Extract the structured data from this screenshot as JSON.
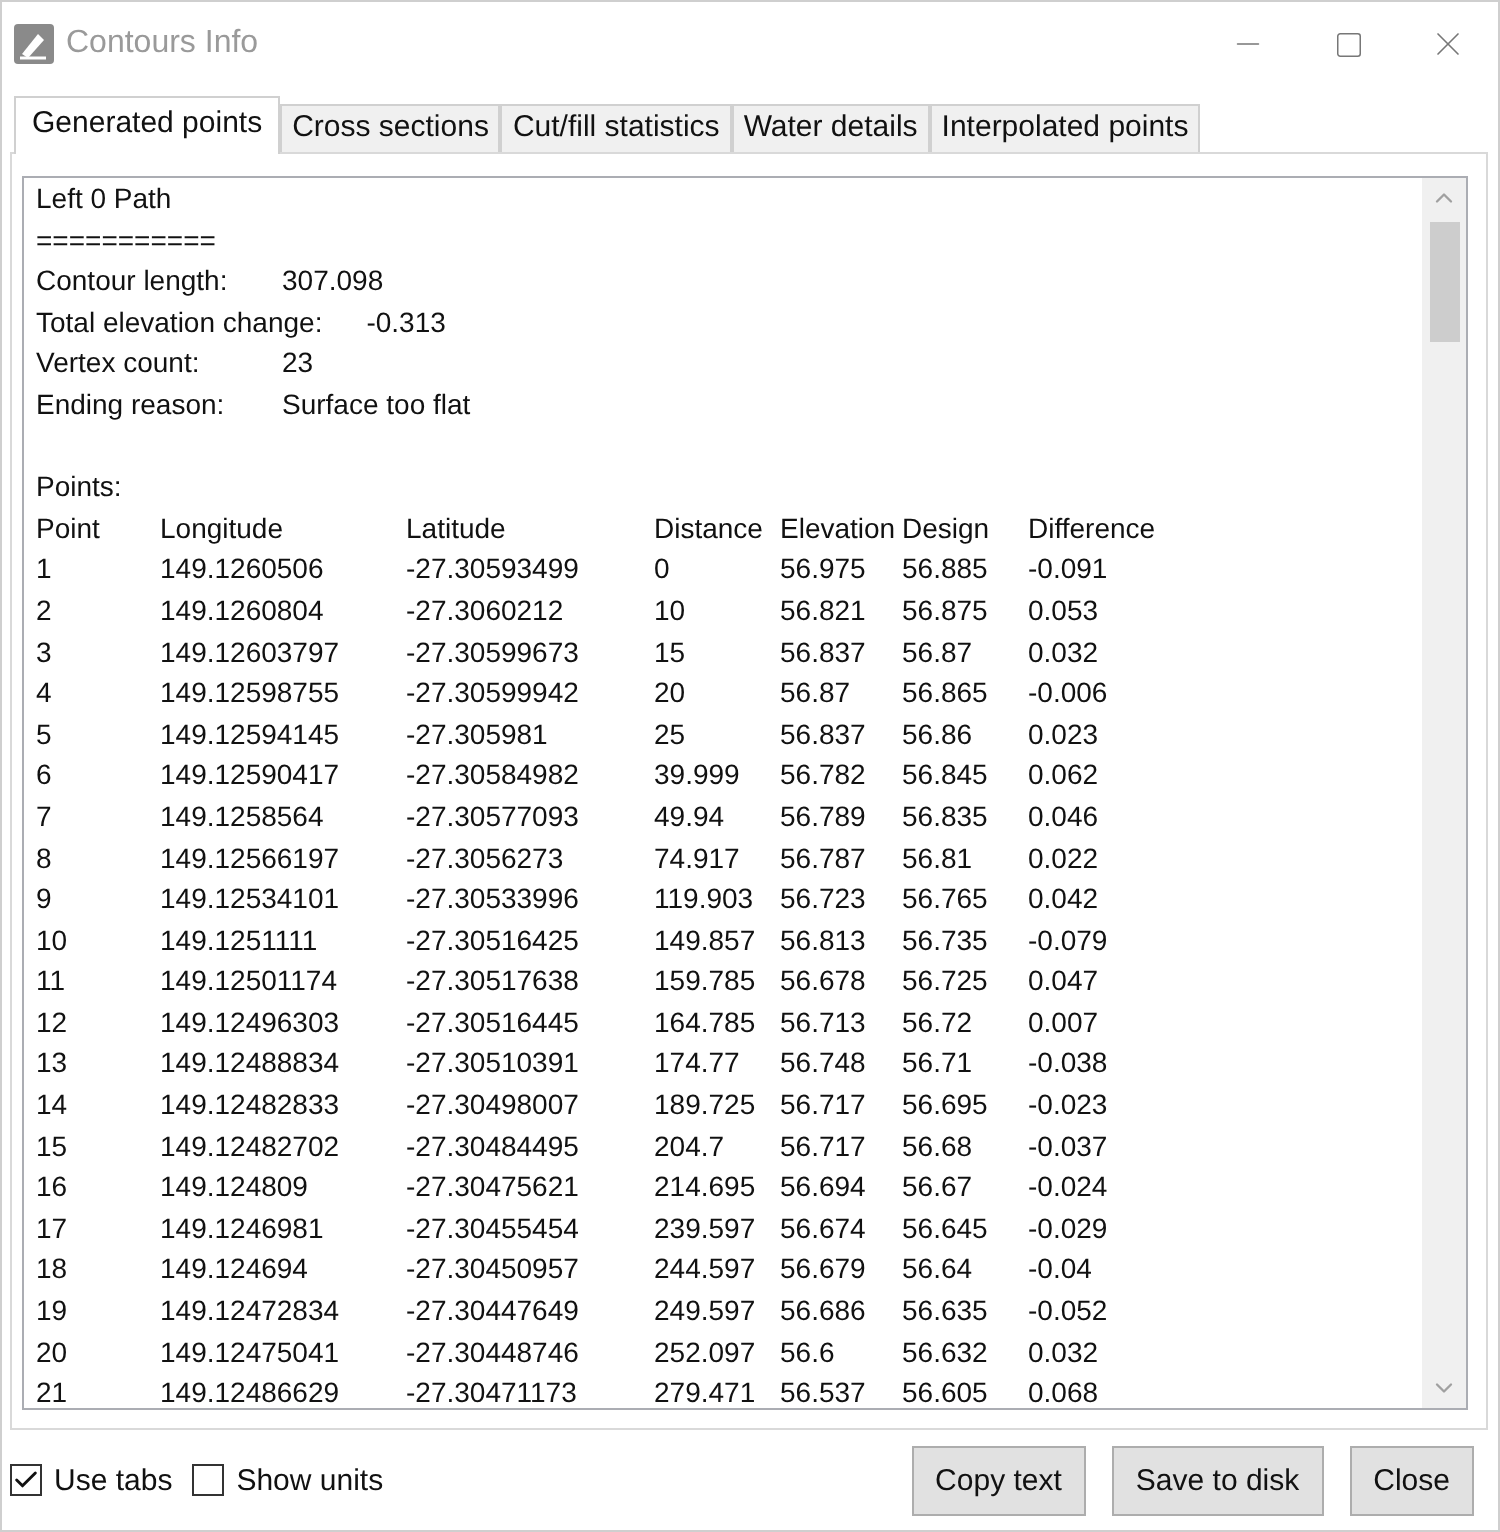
{
  "window": {
    "title": "Contours Info"
  },
  "tabs": [
    {
      "label": "Generated points",
      "selected": true
    },
    {
      "label": "Cross sections",
      "selected": false
    },
    {
      "label": "Cut/fill statistics",
      "selected": false
    },
    {
      "label": "Water details",
      "selected": false
    },
    {
      "label": "Interpolated points",
      "selected": false
    }
  ],
  "report": {
    "title": "Left 0 Path",
    "rule": "===========",
    "info": [
      {
        "label": "Contour length:",
        "value": "307.098"
      },
      {
        "label": "Total elevation change:",
        "value": "-0.313"
      },
      {
        "label": "Vertex count:",
        "value": "23"
      },
      {
        "label": "Ending reason:",
        "value": "Surface too flat"
      }
    ],
    "points_label": "Points:",
    "columns": [
      "Point",
      "Longitude",
      "Latitude",
      "Distance",
      "Elevation",
      "Design",
      "Difference"
    ],
    "rows": [
      [
        "1",
        "149.1260506",
        "-27.30593499",
        "0",
        "56.975",
        "56.885",
        "-0.091"
      ],
      [
        "2",
        "149.1260804",
        "-27.3060212",
        "10",
        "56.821",
        "56.875",
        "0.053"
      ],
      [
        "3",
        "149.12603797",
        "-27.30599673",
        "15",
        "56.837",
        "56.87",
        "0.032"
      ],
      [
        "4",
        "149.12598755",
        "-27.30599942",
        "20",
        "56.87",
        "56.865",
        "-0.006"
      ],
      [
        "5",
        "149.12594145",
        "-27.305981",
        "25",
        "56.837",
        "56.86",
        "0.023"
      ],
      [
        "6",
        "149.12590417",
        "-27.30584982",
        "39.999",
        "56.782",
        "56.845",
        "0.062"
      ],
      [
        "7",
        "149.1258564",
        "-27.30577093",
        "49.94",
        "56.789",
        "56.835",
        "0.046"
      ],
      [
        "8",
        "149.12566197",
        "-27.3056273",
        "74.917",
        "56.787",
        "56.81",
        "0.022"
      ],
      [
        "9",
        "149.12534101",
        "-27.30533996",
        "119.903",
        "56.723",
        "56.765",
        "0.042"
      ],
      [
        "10",
        "149.1251111",
        "-27.30516425",
        "149.857",
        "56.813",
        "56.735",
        "-0.079"
      ],
      [
        "11",
        "149.12501174",
        "-27.30517638",
        "159.785",
        "56.678",
        "56.725",
        "0.047"
      ],
      [
        "12",
        "149.12496303",
        "-27.30516445",
        "164.785",
        "56.713",
        "56.72",
        "0.007"
      ],
      [
        "13",
        "149.12488834",
        "-27.30510391",
        "174.77",
        "56.748",
        "56.71",
        "-0.038"
      ],
      [
        "14",
        "149.12482833",
        "-27.30498007",
        "189.725",
        "56.717",
        "56.695",
        "-0.023"
      ],
      [
        "15",
        "149.12482702",
        "-27.30484495",
        "204.7",
        "56.717",
        "56.68",
        "-0.037"
      ],
      [
        "16",
        "149.124809",
        "-27.30475621",
        "214.695",
        "56.694",
        "56.67",
        "-0.024"
      ],
      [
        "17",
        "149.1246981",
        "-27.30455454",
        "239.597",
        "56.674",
        "56.645",
        "-0.029"
      ],
      [
        "18",
        "149.124694",
        "-27.30450957",
        "244.597",
        "56.679",
        "56.64",
        "-0.04"
      ],
      [
        "19",
        "149.12472834",
        "-27.30447649",
        "249.597",
        "56.686",
        "56.635",
        "-0.052"
      ],
      [
        "20",
        "149.12475041",
        "-27.30448746",
        "252.097",
        "56.6",
        "56.632",
        "0.032"
      ],
      [
        "21",
        "149.12486629",
        "-27.30471173",
        "279.471",
        "56.537",
        "56.605",
        "0.068"
      ]
    ]
  },
  "options": [
    {
      "label": "Use tabs",
      "checked": true
    },
    {
      "label": "Show units",
      "checked": false
    }
  ],
  "buttons": [
    "Copy text",
    "Save to disk",
    "Close"
  ]
}
